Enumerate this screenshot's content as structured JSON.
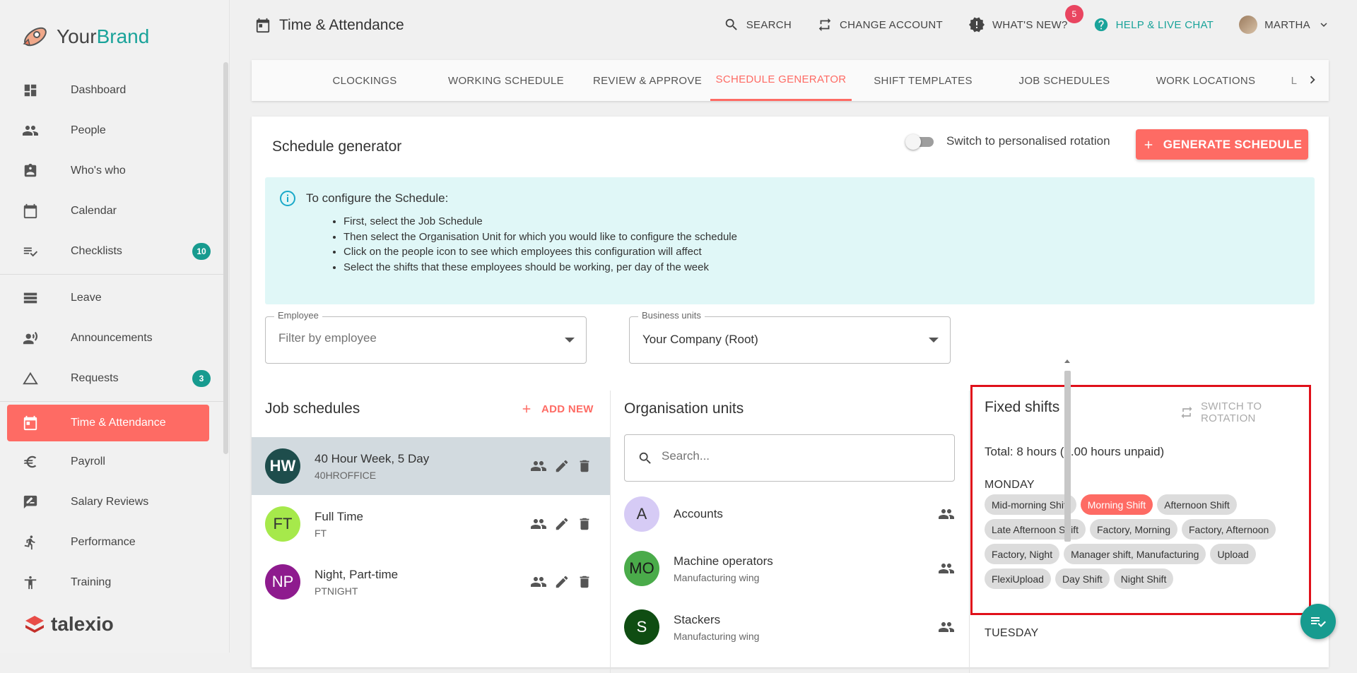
{
  "brand": {
    "part1": "Your",
    "part2": "Brand"
  },
  "footer_brand": "talexio",
  "sidebar": {
    "items": [
      {
        "label": "Dashboard",
        "icon": "dashboard-icon"
      },
      {
        "label": "People",
        "icon": "people-icon"
      },
      {
        "label": "Who's who",
        "icon": "contact-card-icon"
      },
      {
        "label": "Calendar",
        "icon": "calendar-icon"
      },
      {
        "label": "Checklists",
        "icon": "checklist-icon",
        "badge": "10"
      },
      {
        "label": "Leave",
        "icon": "leave-icon"
      },
      {
        "label": "Announcements",
        "icon": "announcement-icon"
      },
      {
        "label": "Requests",
        "icon": "triangle-icon",
        "badge": "3"
      },
      {
        "label": "Time & Attendance",
        "icon": "calendar-today-icon"
      },
      {
        "label": "Payroll",
        "icon": "euro-icon"
      },
      {
        "label": "Salary Reviews",
        "icon": "rate-review-icon"
      },
      {
        "label": "Performance",
        "icon": "run-icon"
      },
      {
        "label": "Training",
        "icon": "accessibility-icon"
      }
    ]
  },
  "header": {
    "title": "Time & Attendance",
    "search": "SEARCH",
    "change_account": "CHANGE ACCOUNT",
    "whats_new": "WHAT'S NEW?",
    "whats_new_count": "5",
    "help": "HELP & LIVE CHAT",
    "user": "MARTHA"
  },
  "tabs": [
    "CLOCKINGS",
    "WORKING SCHEDULE",
    "REVIEW & APPROVE",
    "SCHEDULE GENERATOR",
    "SHIFT TEMPLATES",
    "JOB SCHEDULES",
    "WORK LOCATIONS",
    "L"
  ],
  "active_tab": "SCHEDULE GENERATOR",
  "card": {
    "title": "Schedule generator",
    "toggle_label": "Switch to personalised rotation",
    "generate_label": "GENERATE SCHEDULE"
  },
  "info": {
    "heading": "To configure the Schedule:",
    "steps": [
      "First, select the Job Schedule",
      "Then select the Organisation Unit for which you would like to configure the schedule",
      "Click on the people icon to see which employees this configuration will affect",
      "Select the shifts that these employees should be working, per day of the week"
    ]
  },
  "filters": {
    "employee_label": "Employee",
    "employee_placeholder": "Filter by employee",
    "business_label": "Business units",
    "business_value": "Your Company (Root)"
  },
  "job_schedules": {
    "title": "Job schedules",
    "add_new": "ADD NEW",
    "items": [
      {
        "initials": "HW",
        "name": "40 Hour Week, 5 Day",
        "code": "40HROFFICE",
        "color": "#1e4d4c",
        "text_color": "#ffffff"
      },
      {
        "initials": "FT",
        "name": "Full Time",
        "code": "FT",
        "color": "#a6e94b",
        "text_color": "#333333"
      },
      {
        "initials": "NP",
        "name": "Night, Part-time",
        "code": "PTNIGHT",
        "color": "#8e1b8e",
        "text_color": "#ffffff"
      }
    ]
  },
  "org_units": {
    "title": "Organisation units",
    "search_placeholder": "Search...",
    "items": [
      {
        "initials": "A",
        "name": "Accounts",
        "sub": "",
        "color": "#d6cbf5",
        "text_color": "#333333"
      },
      {
        "initials": "MO",
        "name": "Machine operators",
        "sub": "Manufacturing wing",
        "color": "#4aab4a",
        "text_color": "#1a1a1a"
      },
      {
        "initials": "S",
        "name": "Stackers",
        "sub": "Manufacturing wing",
        "color": "#0f4d12",
        "text_color": "#ffffff"
      }
    ]
  },
  "fixed_shifts": {
    "title": "Fixed shifts",
    "switch_label": "SWITCH TO ROTATION",
    "total": "Total: 8 hours (1.00 hours unpaid)",
    "days": [
      {
        "name": "MONDAY",
        "shifts": [
          "Mid-morning Shift",
          "Morning Shift",
          "Afternoon Shift",
          "Late Afternoon Shift",
          "Factory, Morning",
          "Factory, Afternoon",
          "Factory, Night",
          "Manager shift, Manufacturing",
          "Upload",
          "FlexiUpload",
          "Day Shift",
          "Night Shift"
        ],
        "selected": "Morning Shift"
      },
      {
        "name": "TUESDAY"
      }
    ]
  },
  "colors": {
    "accent": "#fe6b64",
    "teal": "#179b8f",
    "info_bg": "#e0f7f7",
    "highlight_border": "#e0101a"
  }
}
